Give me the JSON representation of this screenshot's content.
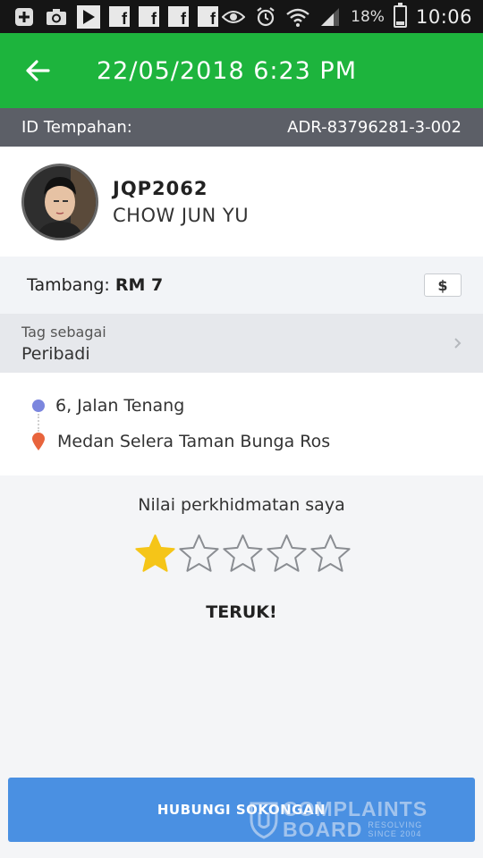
{
  "status_bar": {
    "battery_percent": "18%",
    "battery_level": 0.18,
    "time": "10:06",
    "left_icons": [
      "add-icon",
      "camera-icon",
      "play-store-icon",
      "facebook-icon",
      "facebook-icon",
      "facebook-icon",
      "facebook-icon"
    ],
    "right_icons": [
      "eye-icon",
      "alarm-icon",
      "wifi-icon",
      "signal-icon",
      "battery-icon"
    ]
  },
  "app_bar": {
    "title": "22/05/2018 6:23 PM",
    "color": "#1db43d"
  },
  "booking": {
    "label": "ID Tempahan:",
    "value": "ADR-83796281-3-002"
  },
  "driver": {
    "plate": "JQP2062",
    "name": "CHOW JUN YU"
  },
  "fare": {
    "label": "Tambang:",
    "value": "RM 7",
    "payment_icon": "$"
  },
  "tag": {
    "label": "Tag sebagai",
    "value": "Peribadi"
  },
  "route": {
    "pickup": "6, Jalan Tenang",
    "dropoff": "Medan Selera Taman Bunga Ros"
  },
  "rating": {
    "prompt": "Nilai perkhidmatan saya",
    "value": 1,
    "max": 5,
    "word": "TERUK!",
    "filled_color": "#f5c518"
  },
  "support": {
    "button_label": "HUBUNGI SOKONGAN"
  },
  "watermark": {
    "line1": "COMPLAINTS",
    "line2": "BOARD",
    "tagline1": "RESOLVING",
    "tagline2": "SINCE 2004"
  }
}
